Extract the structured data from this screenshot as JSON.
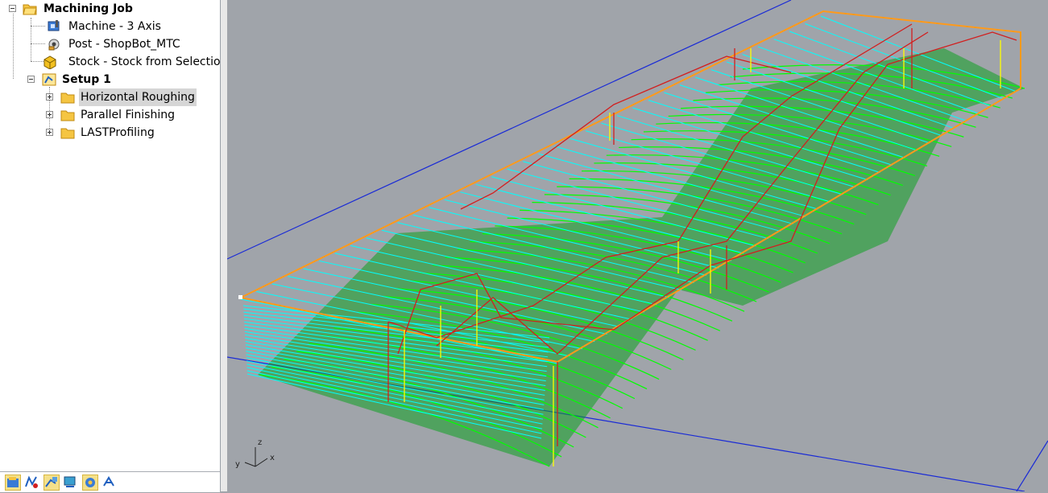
{
  "tree": {
    "root": {
      "label": "Machining Job",
      "icon": "folder-job-icon"
    },
    "machine": {
      "label": "Machine - 3 Axis",
      "icon": "machine-icon"
    },
    "post": {
      "label": "Post - ShopBot_MTC",
      "icon": "post-icon"
    },
    "stock": {
      "label": "Stock - Stock from Selection",
      "icon": "stock-box-icon"
    },
    "setup": {
      "label": "Setup 1",
      "icon": "setup-icon"
    },
    "operations": [
      {
        "label": "Horizontal Roughing",
        "icon": "folder-icon",
        "selected": true
      },
      {
        "label": "Parallel Finishing",
        "icon": "folder-icon",
        "selected": false
      },
      {
        "label": "LASTProfiling",
        "icon": "folder-icon",
        "selected": false
      }
    ]
  },
  "toolbar": {
    "buttons": [
      {
        "name": "machining-job-tab",
        "active": true
      },
      {
        "name": "toolpath-tab",
        "active": false
      },
      {
        "name": "simulate-tab",
        "active": true
      },
      {
        "name": "stock-tab",
        "active": false
      },
      {
        "name": "setup-tab",
        "active": true
      },
      {
        "name": "post-tab",
        "active": false
      }
    ]
  },
  "viewport": {
    "axis_labels": {
      "z": "z",
      "y": "y",
      "x": "x"
    },
    "colors": {
      "background": "#a0a4aa",
      "grid_axis": "#1a2bd6",
      "roughing": "#00ffff",
      "finishing": "#00e000",
      "rapid": "#d21e1e",
      "plunge": "#ffff00",
      "stock": "#ff9a1a"
    }
  }
}
